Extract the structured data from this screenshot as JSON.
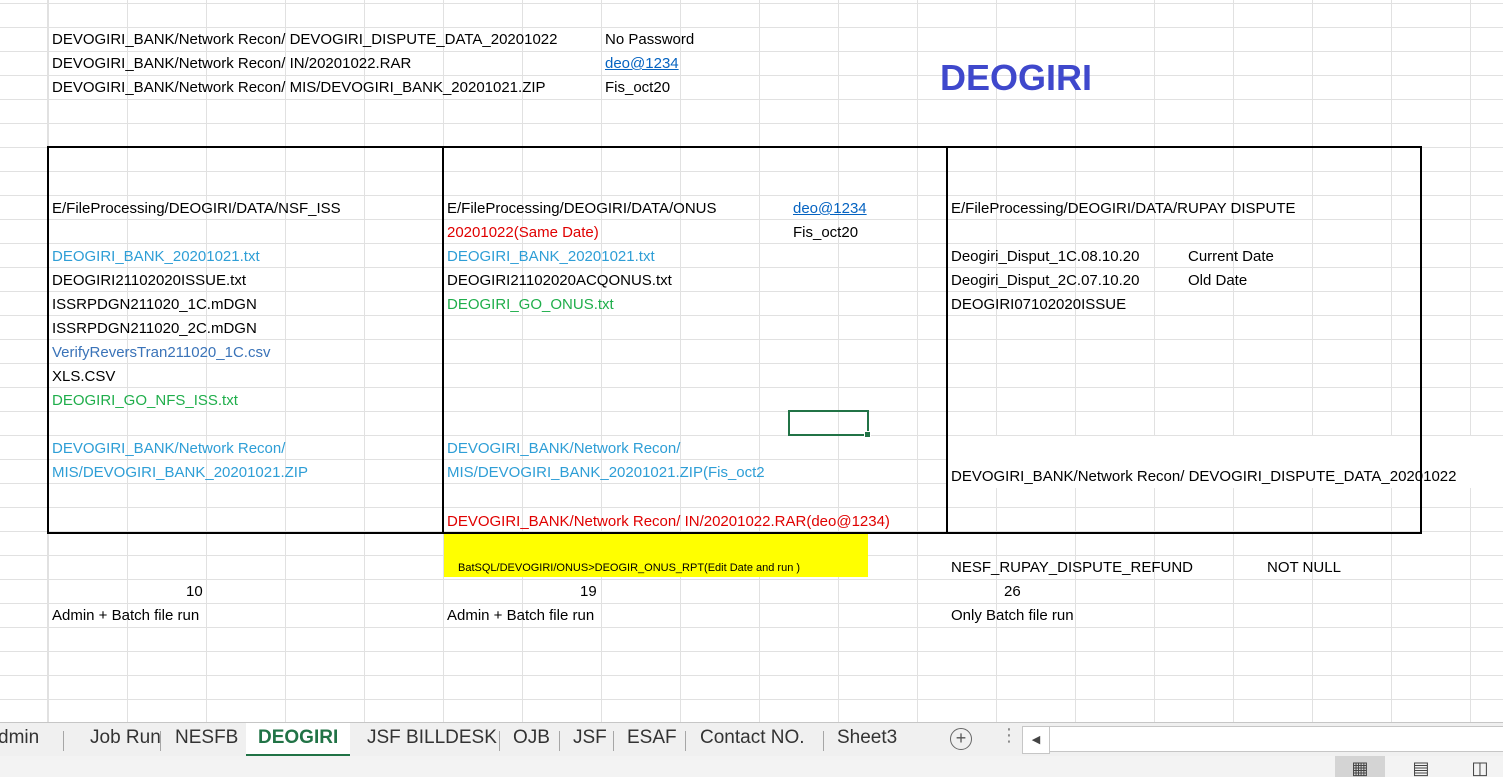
{
  "sheet": {
    "title": "DEOGIRI",
    "top_paths": [
      "DEVOGIRI_BANK/Network Recon/ DEVOGIRI_DISPUTE_DATA_20201022",
      "DEVOGIRI_BANK/Network Recon/ IN/20201022.RAR",
      "DEVOGIRI_BANK/Network Recon/ MIS/DEVOGIRI_BANK_20201021.ZIP"
    ],
    "top_passwords": [
      "No Password",
      "deo@1234",
      "Fis_oct20"
    ],
    "col1": {
      "header": "E/FileProcessing/DEOGIRI/DATA/NSF_ISS",
      "files": [
        "DEOGIRI_BANK_20201021.txt",
        "DEOGIRI21102020ISSUE.txt",
        "ISSRPDGN211020_1C.mDGN",
        "ISSRPDGN211020_2C.mDGN",
        "VerifyReversTran211020_1C.csv",
        "XLS.CSV",
        "DEOGIRI_GO_NFS_ISS.txt"
      ],
      "mis_line1": "DEVOGIRI_BANK/Network Recon/",
      "mis_line2": "MIS/DEVOGIRI_BANK_20201021.ZIP",
      "count": "10",
      "run": "Admin + Batch file run"
    },
    "col2": {
      "header": "E/FileProcessing/DEOGIRI/DATA/ONUS",
      "password": "deo@1234",
      "same_date": "20201022(Same Date)",
      "password2": "Fis_oct20",
      "files": [
        "DEOGIRI_BANK_20201021.txt",
        "DEOGIRI21102020ACQONUS.txt",
        "DEOGIRI_GO_ONUS.txt"
      ],
      "mis_line1": "DEVOGIRI_BANK/Network Recon/",
      "mis_line2": "MIS/DEVOGIRI_BANK_20201021.ZIP(Fis_oct2",
      "rar_line": "DEVOGIRI_BANK/Network Recon/ IN/20201022.RAR(deo@1234)",
      "batsql": "BatSQL/DEVOGIRI/ONUS>DEOGIR_ONUS_RPT(Edit Date and run )",
      "count": "19",
      "run": "Admin + Batch file run"
    },
    "col3": {
      "header": "E/FileProcessing/DEOGIRI/DATA/RUPAY DISPUTE",
      "files": [
        "Deogiri_Disput_1C.08.10.20",
        "Deogiri_Disput_2C.07.10.20",
        "DEOGIRI07102020ISSUE"
      ],
      "notes": [
        "Current Date",
        "Old Date"
      ],
      "dispute_line": "DEVOGIRI_BANK/Network Recon/ DEVOGIRI_DISPUTE_DATA_20201022",
      "refund": "NESF_RUPAY_DISPUTE_REFUND",
      "not_null": "NOT NULL",
      "count": "26",
      "run": "Only Batch file run"
    }
  },
  "tabs": [
    "dmin",
    "Job Run",
    "NESFB",
    "DEOGIRI",
    "JSF BILLDESK",
    "OJB",
    "JSF",
    "ESAF",
    "Contact NO.",
    "Sheet3"
  ],
  "active_tab": "DEOGIRI",
  "colors": {
    "title": "#3f48cc",
    "file_blue": "#2e9ed6",
    "file_green": "#1fae4b",
    "alert_red": "#e00000",
    "highlight_yellow": "#ffff00",
    "excel_green": "#217346"
  },
  "icons": {
    "add_sheet": "plus-circle-icon",
    "more": "vertical-dots-icon",
    "scroll_left": "triangle-left-icon",
    "normal_view": "grid-icon",
    "page_layout": "page-layout-icon",
    "page_break": "page-break-icon"
  }
}
